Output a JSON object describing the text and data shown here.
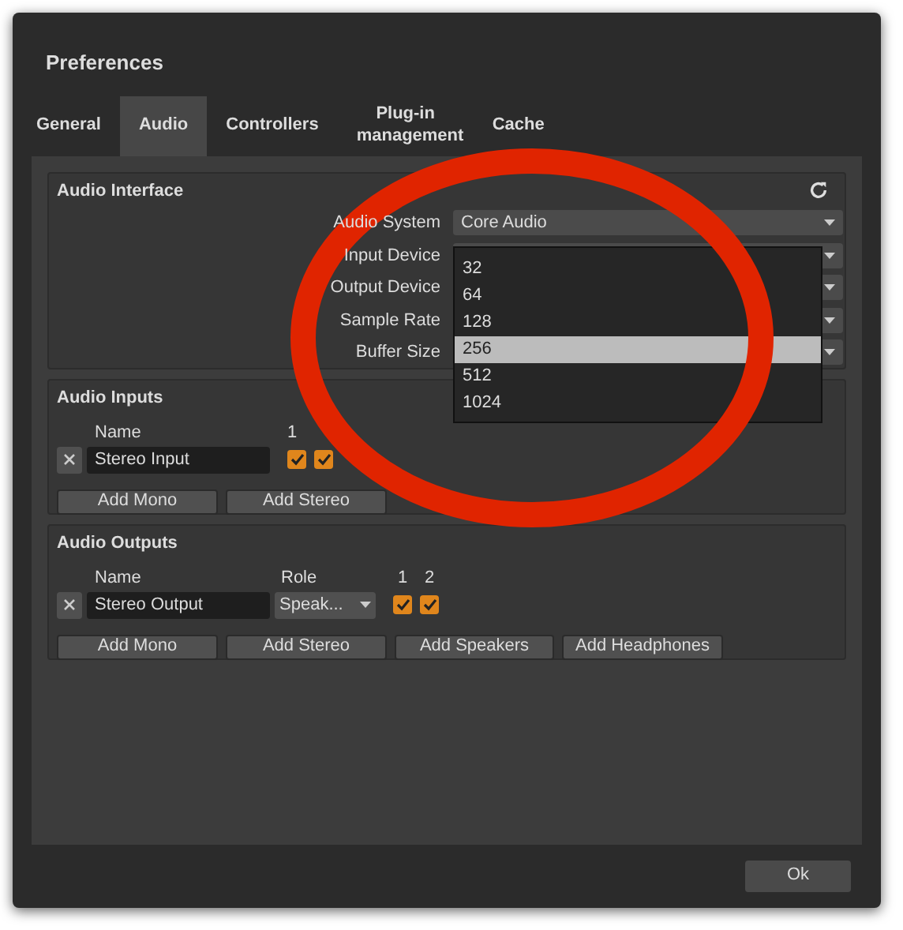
{
  "window": {
    "title": "Preferences"
  },
  "tabs": [
    {
      "label": "General",
      "selected": false
    },
    {
      "label": "Audio",
      "selected": true
    },
    {
      "label": "Controllers",
      "selected": false
    },
    {
      "label": "Plug-in management",
      "selected": false
    },
    {
      "label": "Cache",
      "selected": false
    }
  ],
  "audio_interface": {
    "title": "Audio Interface",
    "fields": [
      {
        "label": "Audio System",
        "value": "Core Audio"
      },
      {
        "label": "Input Device"
      },
      {
        "label": "Output Device"
      },
      {
        "label": "Sample Rate"
      },
      {
        "label": "Buffer Size"
      }
    ],
    "dropdown": [
      {
        "label": "32",
        "selected": false
      },
      {
        "label": "64",
        "selected": false
      },
      {
        "label": "128",
        "selected": false
      },
      {
        "label": "256",
        "selected": true
      },
      {
        "label": "512",
        "selected": false
      },
      {
        "label": "1024",
        "selected": false
      }
    ]
  },
  "audio_inputs": {
    "title": "Audio Inputs",
    "columns": [
      "Name",
      "1"
    ],
    "rows": [
      {
        "name": "Stereo Input",
        "channels": [
          {
            "checked": true
          },
          {
            "checked": true
          }
        ]
      }
    ],
    "buttons": [
      "Add Mono",
      "Add Stereo"
    ]
  },
  "audio_outputs": {
    "title": "Audio Outputs",
    "columns": [
      "Name",
      "Role",
      "1",
      "2"
    ],
    "rows": [
      {
        "name": "Stereo Output",
        "role": "Speak...",
        "channels": [
          {
            "checked": true
          },
          {
            "checked": true
          }
        ]
      }
    ],
    "buttons": [
      "Add Mono",
      "Add Stereo",
      "Add Speakers",
      "Add Headphones"
    ]
  },
  "footer": {
    "buttons": [
      "Ok"
    ]
  }
}
